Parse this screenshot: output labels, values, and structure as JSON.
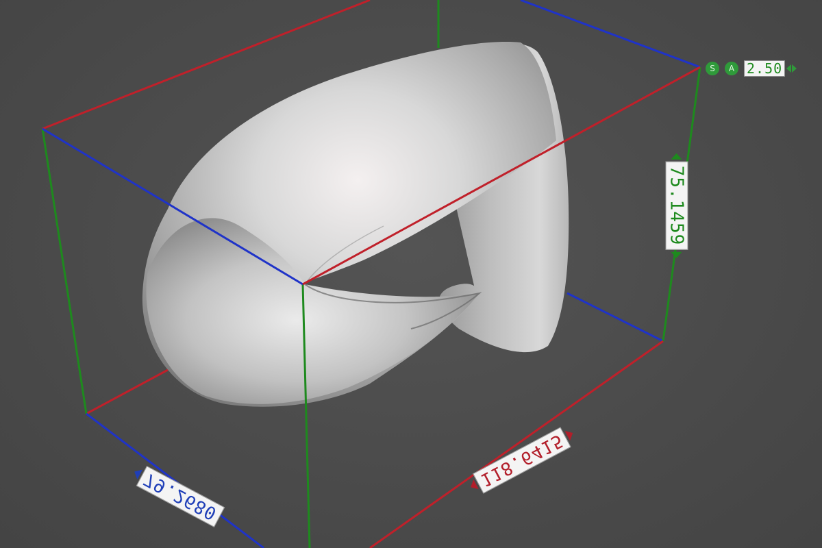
{
  "viewport": {
    "background": "#4b4b4b"
  },
  "bounding_box": {
    "colors": {
      "x_axis": "#c0202a",
      "y_axis": "#1f33c8",
      "z_axis": "#1e8a1e"
    }
  },
  "dimensions": {
    "z": {
      "value": "75.1459",
      "color": "#1e8a1e"
    },
    "x": {
      "value": "118.6415",
      "color": "#b21e2a"
    },
    "y": {
      "value": "79.2680",
      "color": "#1f3fb8"
    }
  },
  "snap": {
    "s_button_label": "S",
    "a_button_label": "A",
    "value": "2.50"
  },
  "icons": {
    "snap_left": "chevron-left-icon",
    "snap_right": "chevron-right-icon"
  }
}
